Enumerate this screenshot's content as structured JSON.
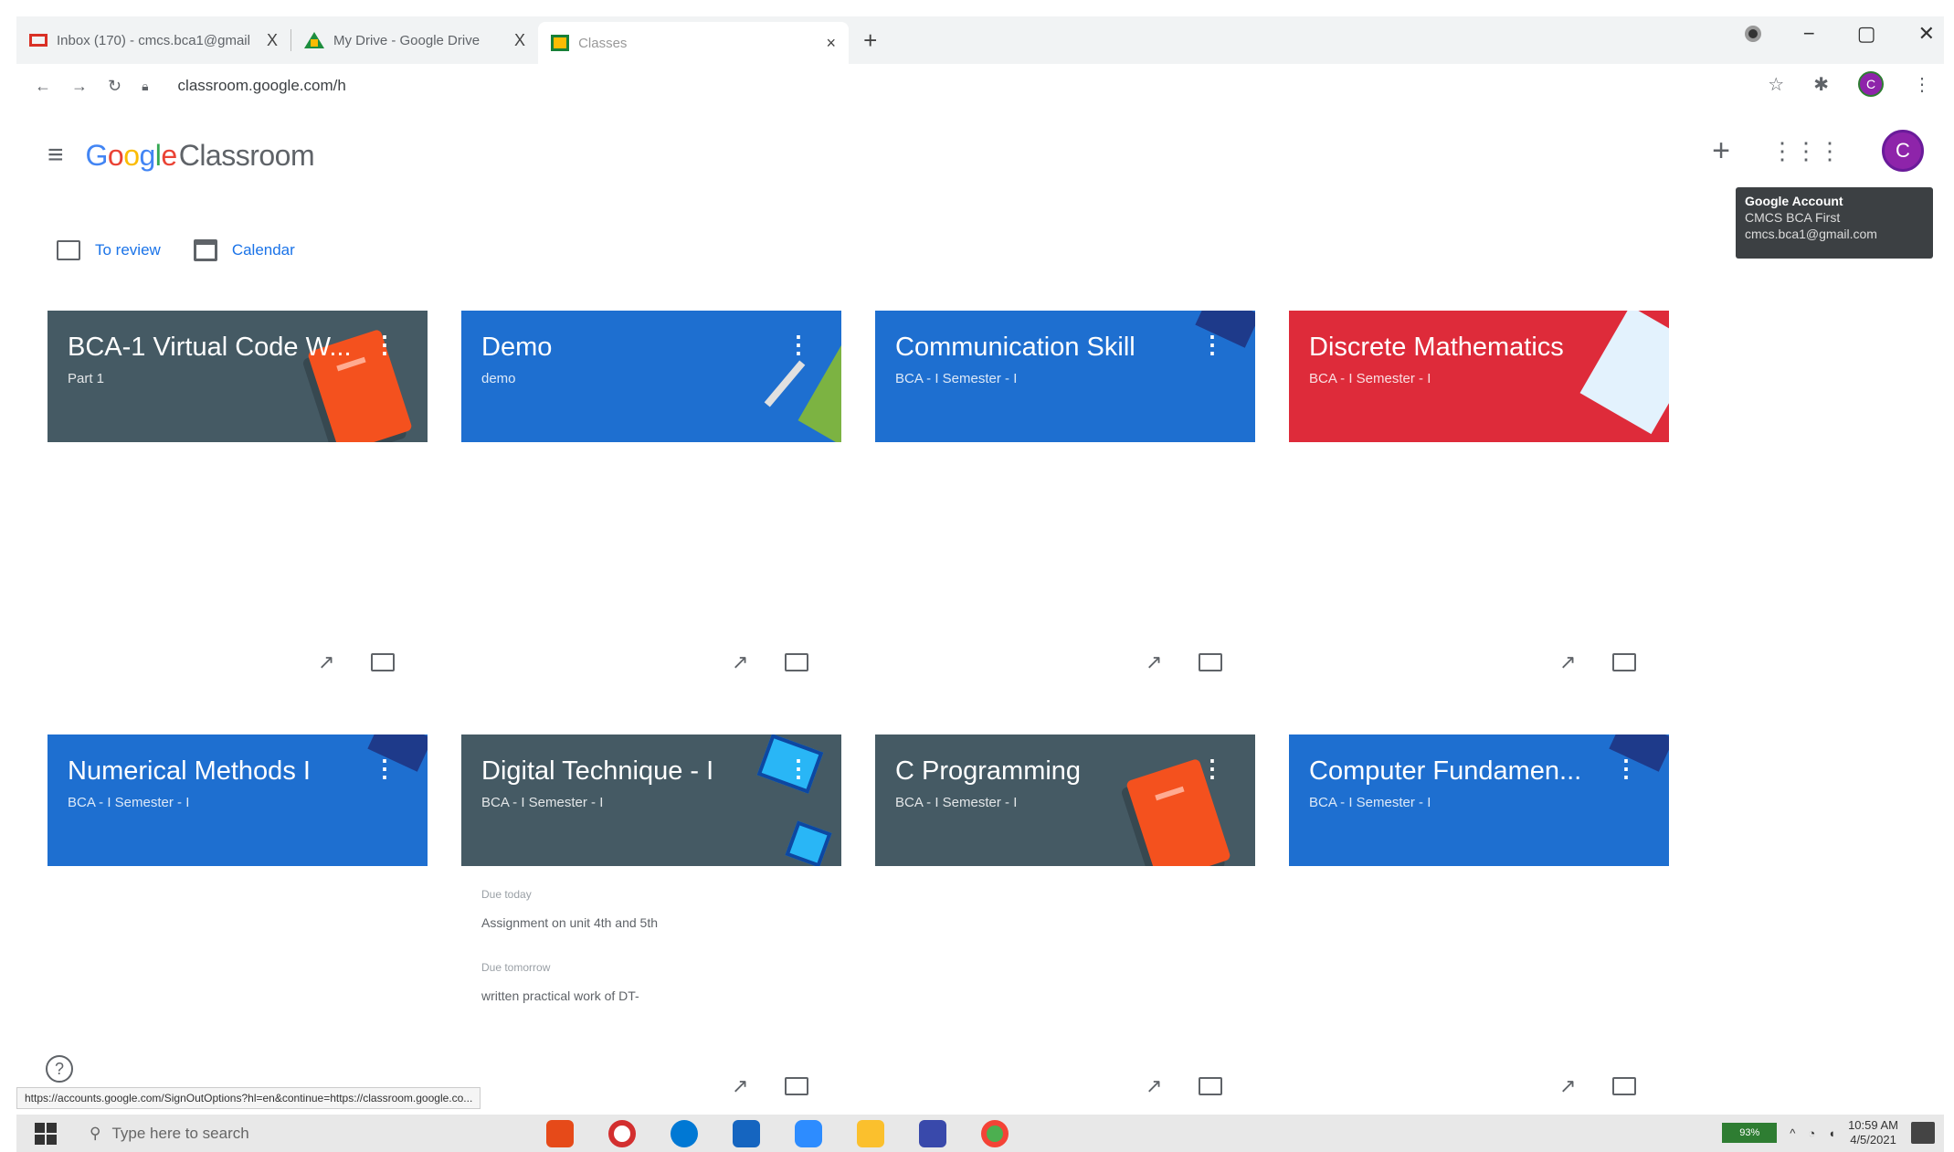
{
  "browser": {
    "tabs": [
      {
        "title": "Inbox (170) - cmcs.bca1@gmail",
        "close": "X",
        "favicon": "gmail-icon"
      },
      {
        "title": "My Drive - Google Drive",
        "close": "X",
        "favicon": "drive-icon"
      },
      {
        "title": "Classes",
        "close": "×",
        "favicon": "classroom-icon"
      }
    ],
    "new_tab": "+",
    "url": "classroom.google.com/h"
  },
  "app": {
    "logo_parts": [
      "G",
      "o",
      "o",
      "g",
      "l",
      "e"
    ],
    "logo_product": "Classroom",
    "create_label": "+",
    "apps_label": "⋮⋮⋮",
    "avatar_letter": "C"
  },
  "tooltip": {
    "title": "Google Account",
    "name": "CMCS BCA First",
    "email": "cmcs.bca1@gmail.com"
  },
  "subnav": {
    "to_review": "To review",
    "calendar": "Calendar"
  },
  "cards": [
    {
      "title": "BCA-1 Virtual Code W...",
      "sub": "Part 1"
    },
    {
      "title": "Demo",
      "sub": "demo"
    },
    {
      "title": "Communication Skill",
      "sub": "BCA - I Semester - I"
    },
    {
      "title": "Discrete Mathematics",
      "sub": "BCA - I Semester - I"
    },
    {
      "title": "Numerical Methods I",
      "sub": "BCA - I Semester - I"
    },
    {
      "title": "Digital Technique - I",
      "sub": "BCA - I Semester - I"
    },
    {
      "title": "C Programming",
      "sub": "BCA - I Semester - I"
    },
    {
      "title": "Computer Fundamen...",
      "sub": "BCA - I Semester - I"
    }
  ],
  "digital_card": {
    "due1": "Due today",
    "item1": "Assignment on unit 4th and 5th",
    "due2": "Due tomorrow",
    "item2": "written practical work of DT-"
  },
  "status_url": "https://accounts.google.com/SignOutOptions?hl=en&continue=https://classroom.google.co...",
  "taskbar": {
    "search_placeholder": "Type here to search",
    "battery": "93%",
    "time": "10:59 AM",
    "date": "4/5/2021"
  }
}
